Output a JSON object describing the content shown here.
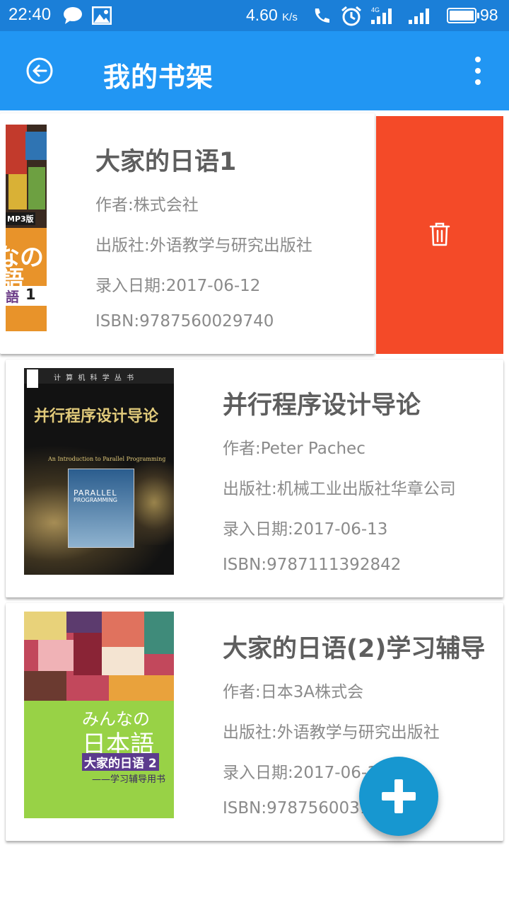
{
  "status_bar": {
    "time": "22:40",
    "net_speed": "4.60",
    "net_unit": "K/s",
    "signal_label": "4G",
    "battery": "98",
    "icons": [
      "message-icon",
      "image-icon",
      "hd-call-icon",
      "alarm-icon",
      "signal-4g-icon",
      "signal-icon",
      "battery-icon"
    ]
  },
  "app_bar": {
    "title": "我的书架",
    "back_icon": "back-arrow-icon",
    "more_icon": "more-vert-icon",
    "color": "#2196f3"
  },
  "books": [
    {
      "title": "大家的日语1",
      "author": "作者:株式会社",
      "publisher": "出版社:外语教学与研究出版社",
      "date": "录入日期:2017-06-12",
      "isbn": "ISBN:9787560029740",
      "cover_text": [
        "MP3版",
        "なの",
        "語",
        "語",
        "1"
      ]
    },
    {
      "title": "并行程序设计导论",
      "author": "作者:Peter Pachec",
      "publisher": "出版社:机械工业出版社华章公司",
      "date": "录入日期:2017-06-13",
      "isbn": "ISBN:9787111392842",
      "cover_text": [
        "计 算 机 科 学 丛 书",
        "并行程序设计导论",
        "An Introduction to Parallel Programming",
        "PARALLEL",
        "PROGRAMMING"
      ]
    },
    {
      "title": "大家的日语(2)学习辅导",
      "author": "作者:日本3A株式会",
      "publisher": "出版社:外语教学与研究出版社",
      "date": "录入日期:2017-06-12",
      "isbn": "ISBN:9787560031422",
      "cover_text": [
        "みんなの",
        "日本語",
        "大家的日语 2",
        "——学习辅导用书"
      ]
    }
  ],
  "swipe_action": {
    "icon": "trash-icon",
    "color": "#f44a28"
  },
  "fab": {
    "icon": "plus-icon",
    "color": "#1797d0"
  }
}
